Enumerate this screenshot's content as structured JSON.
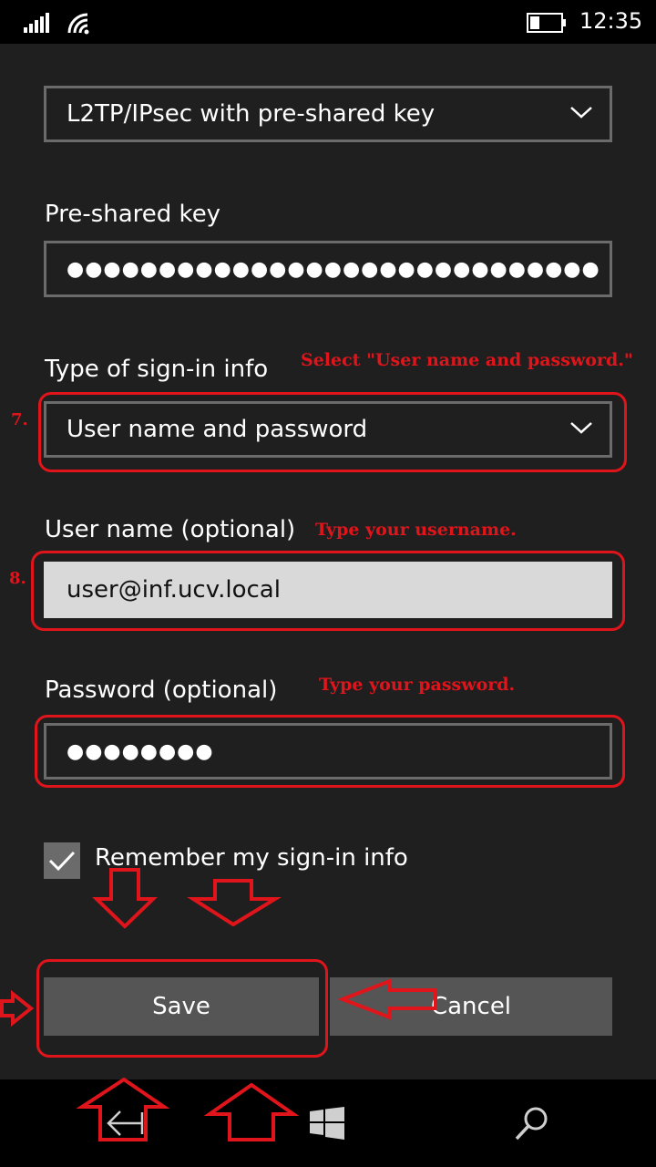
{
  "status_bar": {
    "time": "12:35",
    "icons": [
      "signal-icon",
      "wifi-icon",
      "battery-icon"
    ]
  },
  "form": {
    "vpn_type": {
      "value": "L2TP/IPsec with pre-shared key"
    },
    "preshared_key": {
      "label": "Pre-shared key",
      "value": "●●●●●●●●●●●●●●●●●●●●●●●●●●●●●"
    },
    "signin_type": {
      "label": "Type of sign-in info",
      "value": "User name and password"
    },
    "username": {
      "label": "User name (optional)",
      "value": "user@inf.ucv.local"
    },
    "password": {
      "label": "Password (optional)",
      "value": "●●●●●●●●"
    },
    "remember": {
      "label": "Remember my sign-in info",
      "checked": true
    }
  },
  "buttons": {
    "save": "Save",
    "cancel": "Cancel"
  },
  "nav_bar": {
    "icons": [
      "back-icon",
      "windows-icon",
      "search-icon"
    ]
  },
  "annotations": {
    "select_note": "Select \"User name and password.\"",
    "username_note": "Type your username.",
    "password_note": "Type your password.",
    "step7": "7.",
    "step8": "8."
  },
  "colors": {
    "background": "#1f1f1f",
    "bar": "#000000",
    "field_border": "#6b6b6b",
    "field_active": "#d9d9d9",
    "button": "#555555",
    "annotation": "#e0151b"
  }
}
